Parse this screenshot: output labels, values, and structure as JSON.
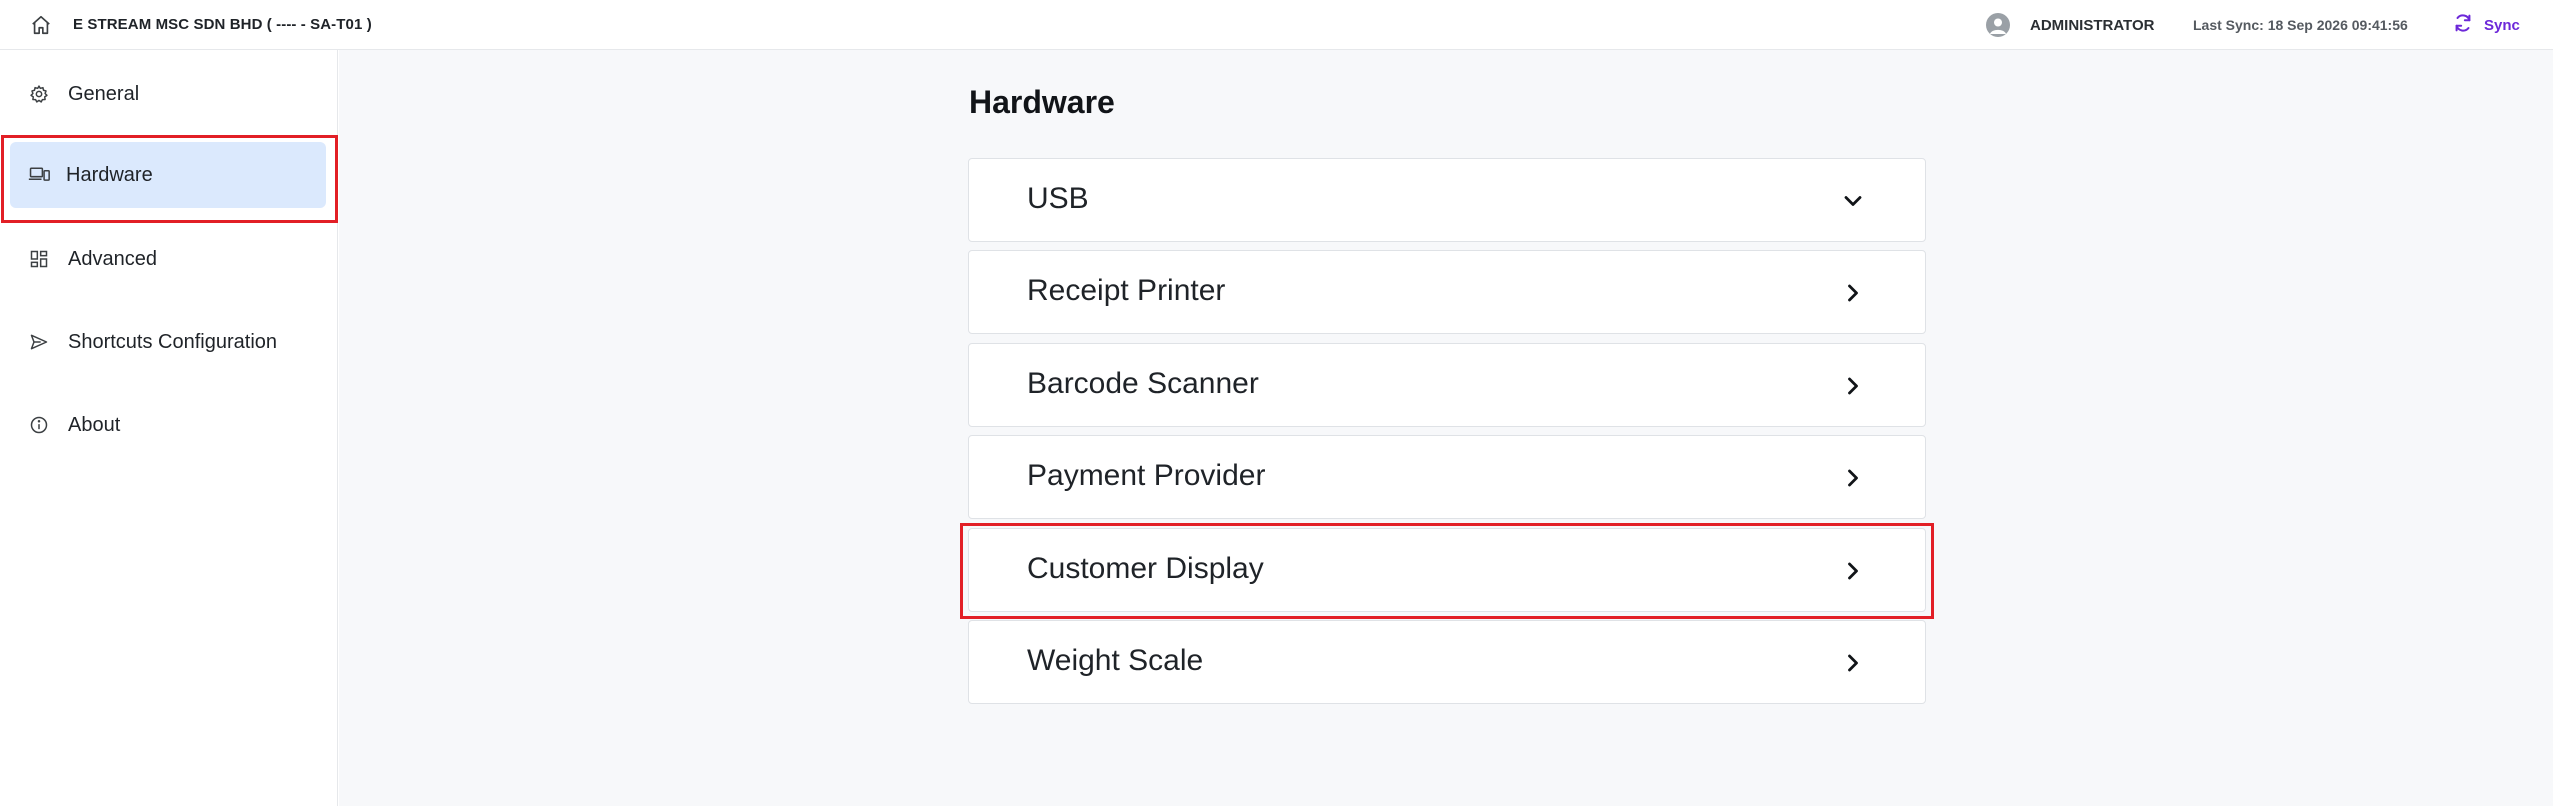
{
  "header": {
    "company": "E STREAM MSC SDN BHD ( ---- - SA-T01 )",
    "username": "ADMINISTRATOR",
    "last_sync": "Last Sync: 18 Sep 2026 09:41:56",
    "sync_label": "Sync",
    "accent_color": "#6d28d9"
  },
  "sidebar": {
    "items": [
      {
        "label": "General",
        "icon": "gear-icon",
        "active": false
      },
      {
        "label": "Hardware",
        "icon": "devices-icon",
        "active": true
      },
      {
        "label": "Advanced",
        "icon": "grid-icon",
        "active": false
      },
      {
        "label": "Shortcuts Configuration",
        "icon": "send-icon",
        "active": false
      },
      {
        "label": "About",
        "icon": "info-icon",
        "active": false
      }
    ]
  },
  "main": {
    "title": "Hardware",
    "sections": [
      {
        "label": "USB",
        "icon": "chevron-down-icon"
      },
      {
        "label": "Receipt Printer",
        "icon": "chevron-right-icon"
      },
      {
        "label": "Barcode Scanner",
        "icon": "chevron-right-icon"
      },
      {
        "label": "Payment Provider",
        "icon": "chevron-right-icon"
      },
      {
        "label": "Customer Display",
        "icon": "chevron-right-icon"
      },
      {
        "label": "Weight Scale",
        "icon": "chevron-right-icon"
      }
    ]
  },
  "highlight_color": "#e21f26"
}
